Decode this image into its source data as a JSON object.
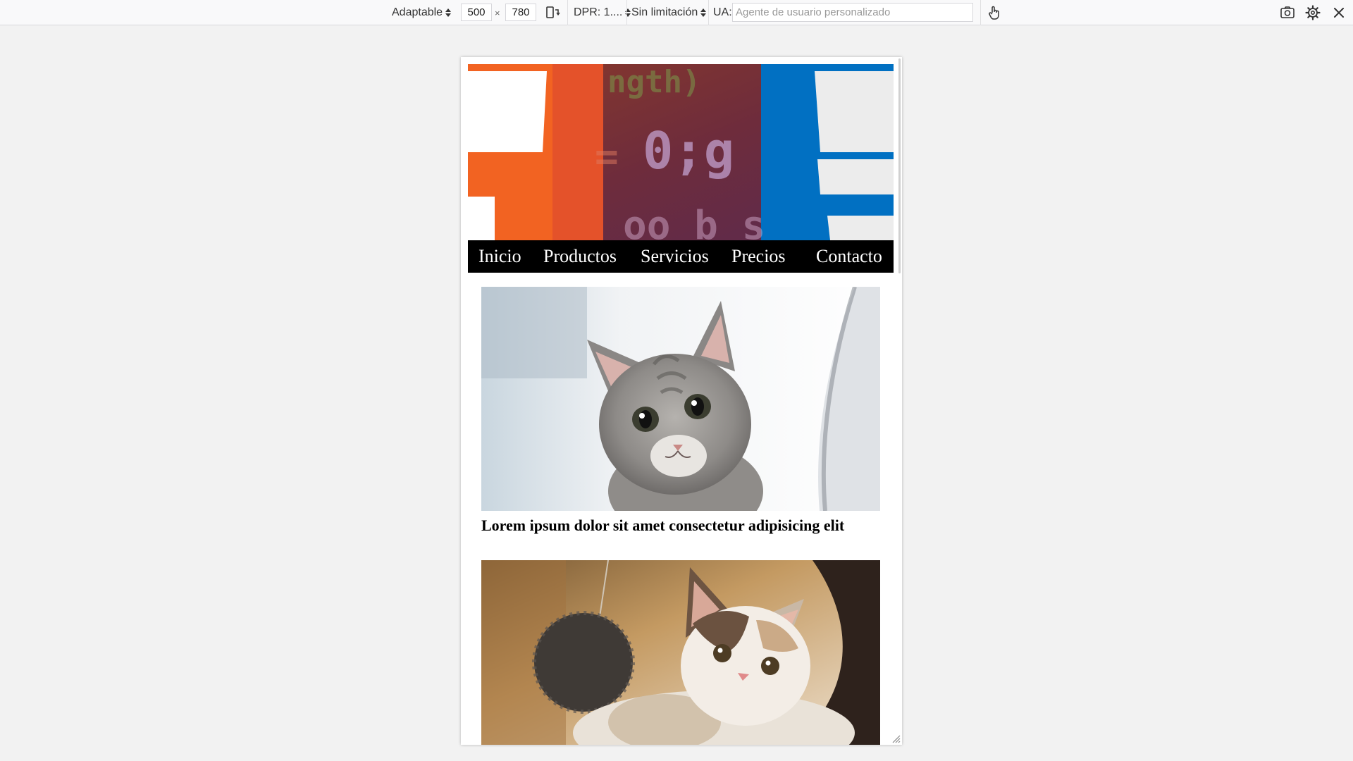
{
  "toolbar": {
    "device": "Adaptable",
    "width": "500",
    "times": "×",
    "height": "780",
    "dpr": "DPR: 1....",
    "throttle": "Sin limitación",
    "ua_label": "UA:",
    "ua_placeholder": "Agente de usuario personalizado",
    "icons": [
      "rotate-icon",
      "touch-icon",
      "screenshot-icon",
      "settings-icon",
      "close-icon"
    ]
  },
  "page": {
    "nav": [
      "Inicio",
      "Productos",
      "Servicios",
      "Precios",
      "Contacto"
    ],
    "caption": "Lorem ipsum dolor sit amet consectetur adipisicing elit",
    "hero_text": "0;g",
    "colors": {
      "orange": "#f26322",
      "blue": "#0170c2",
      "nav_bg": "#000000"
    }
  }
}
